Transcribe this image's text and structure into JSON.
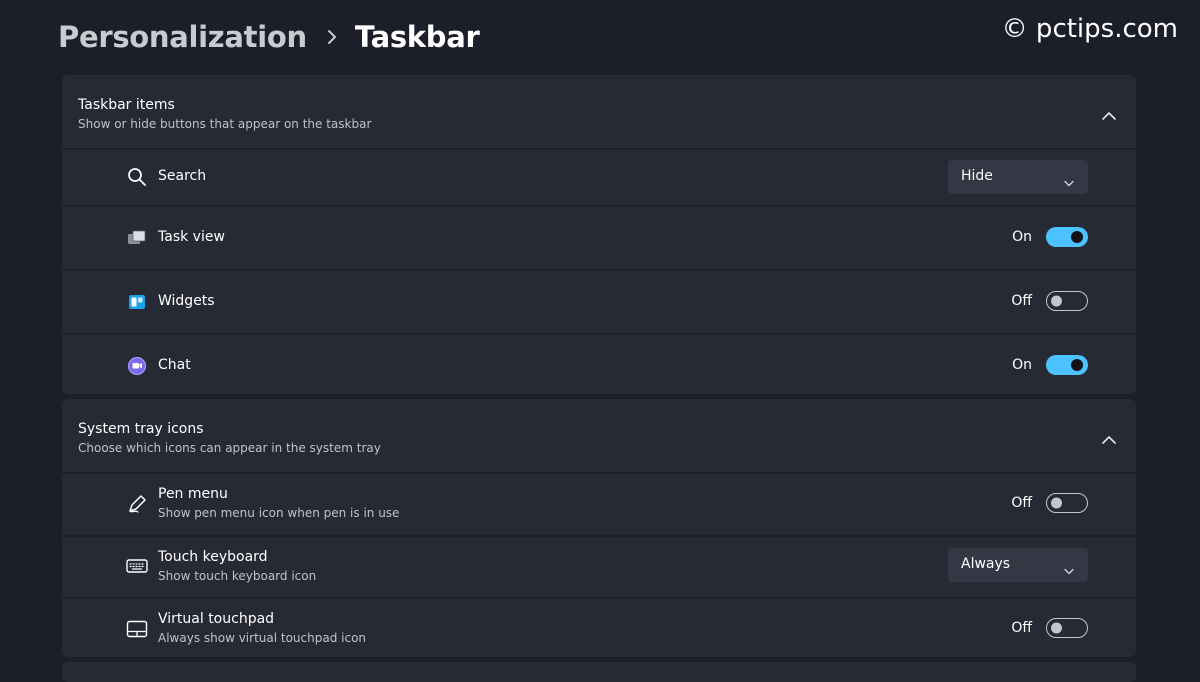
{
  "breadcrumb": {
    "parent": "Personalization",
    "current": "Taskbar"
  },
  "watermark": "© pctips.com",
  "colors": {
    "accent": "#4cc2ff",
    "background": "#1c1f29",
    "card": "#272a35"
  },
  "taskbar_items": {
    "title": "Taskbar items",
    "subtitle": "Show or hide buttons that appear on the taskbar",
    "expanded": true,
    "rows": [
      {
        "label": "Search",
        "icon": "search-icon",
        "control": "dropdown",
        "value": "Hide"
      },
      {
        "label": "Task view",
        "icon": "task-view-icon",
        "control": "toggle",
        "state": "On",
        "on": true
      },
      {
        "label": "Widgets",
        "icon": "widgets-icon",
        "control": "toggle",
        "state": "Off",
        "on": false
      },
      {
        "label": "Chat",
        "icon": "chat-icon",
        "control": "toggle",
        "state": "On",
        "on": true
      }
    ]
  },
  "system_tray": {
    "title": "System tray icons",
    "subtitle": "Choose which icons can appear in the system tray",
    "expanded": true,
    "rows": [
      {
        "label": "Pen menu",
        "sub": "Show pen menu icon when pen is in use",
        "icon": "pen-icon",
        "control": "toggle",
        "state": "Off",
        "on": false
      },
      {
        "label": "Touch keyboard",
        "sub": "Show touch keyboard icon",
        "icon": "keyboard-icon",
        "control": "dropdown",
        "value": "Always"
      },
      {
        "label": "Virtual touchpad",
        "sub": "Always show virtual touchpad icon",
        "icon": "touchpad-icon",
        "control": "toggle",
        "state": "Off",
        "on": false
      }
    ]
  }
}
